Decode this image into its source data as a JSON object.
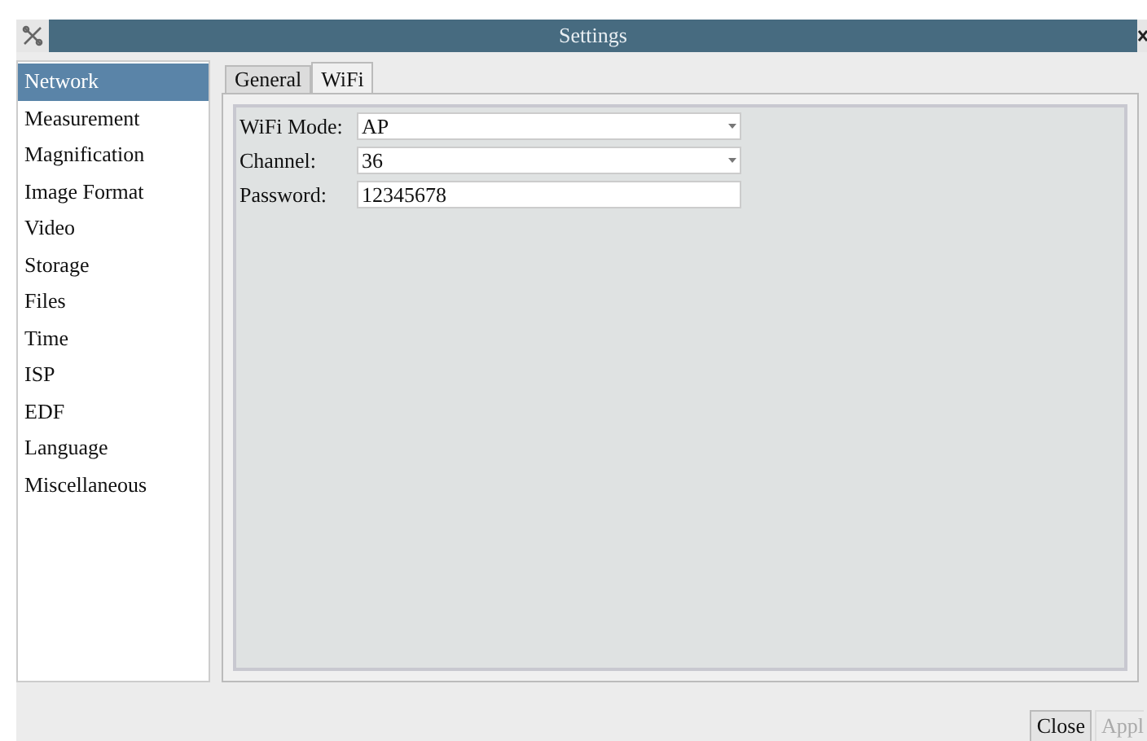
{
  "window": {
    "title": "Settings"
  },
  "sidebar": {
    "items": [
      {
        "label": "Network",
        "selected": true
      },
      {
        "label": "Measurement",
        "selected": false
      },
      {
        "label": "Magnification",
        "selected": false
      },
      {
        "label": "Image Format",
        "selected": false
      },
      {
        "label": "Video",
        "selected": false
      },
      {
        "label": "Storage",
        "selected": false
      },
      {
        "label": "Files",
        "selected": false
      },
      {
        "label": "Time",
        "selected": false
      },
      {
        "label": "ISP",
        "selected": false
      },
      {
        "label": "EDF",
        "selected": false
      },
      {
        "label": "Language",
        "selected": false
      },
      {
        "label": "Miscellaneous",
        "selected": false
      }
    ]
  },
  "tabs": [
    {
      "label": "General",
      "selected": false
    },
    {
      "label": "WiFi",
      "selected": true
    }
  ],
  "fields": [
    {
      "kind": "dropdown",
      "label": "WiFi Mode:",
      "value": "AP"
    },
    {
      "kind": "dropdown",
      "label": "Channel:",
      "value": "36"
    },
    {
      "kind": "text",
      "label": "Password:",
      "value": "12345678"
    }
  ],
  "buttons": [
    {
      "label": "Close",
      "disabled": false
    },
    {
      "label": "Appl",
      "disabled": true
    }
  ]
}
